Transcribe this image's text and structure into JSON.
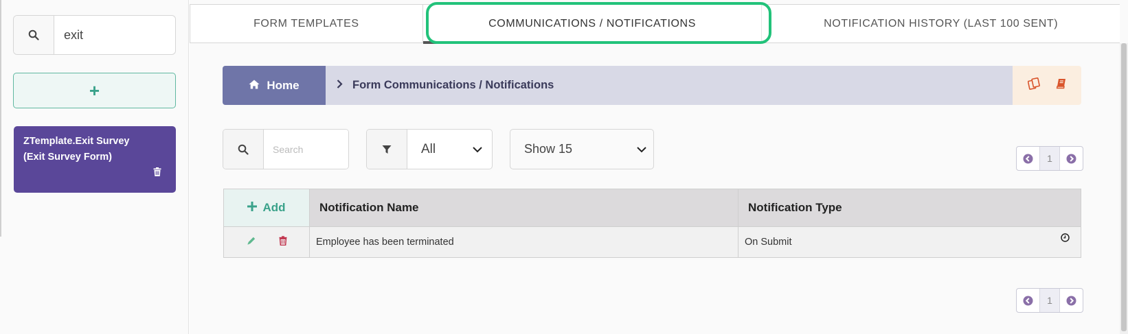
{
  "sidebar": {
    "search_value": "exit",
    "add_label": "+",
    "card": {
      "line1": "ZTemplate.Exit Survey",
      "line2": "(Exit Survey Form)"
    }
  },
  "tabs": [
    {
      "label": "FORM TEMPLATES"
    },
    {
      "label": "COMMUNICATIONS / NOTIFICATIONS"
    },
    {
      "label": "NOTIFICATION HISTORY (LAST 100 SENT)"
    }
  ],
  "breadcrumb": {
    "home": "Home",
    "current": "Form Communications / Notifications"
  },
  "filters": {
    "search_placeholder": "Search",
    "type_value": "All",
    "show_value": "Show 15"
  },
  "pager": {
    "page": "1"
  },
  "table": {
    "add_label": "Add",
    "columns": [
      "Notification Name",
      "Notification Type"
    ],
    "rows": [
      {
        "name": "Employee has been terminated",
        "type": "On Submit"
      }
    ]
  },
  "colors": {
    "accent_teal": "#3aa28a",
    "card_purple": "#5a4799",
    "home_blue": "#6f75a8",
    "highlight_green": "#22c27a",
    "action_orange": "#d9542b",
    "delete_red": "#c0304a"
  }
}
